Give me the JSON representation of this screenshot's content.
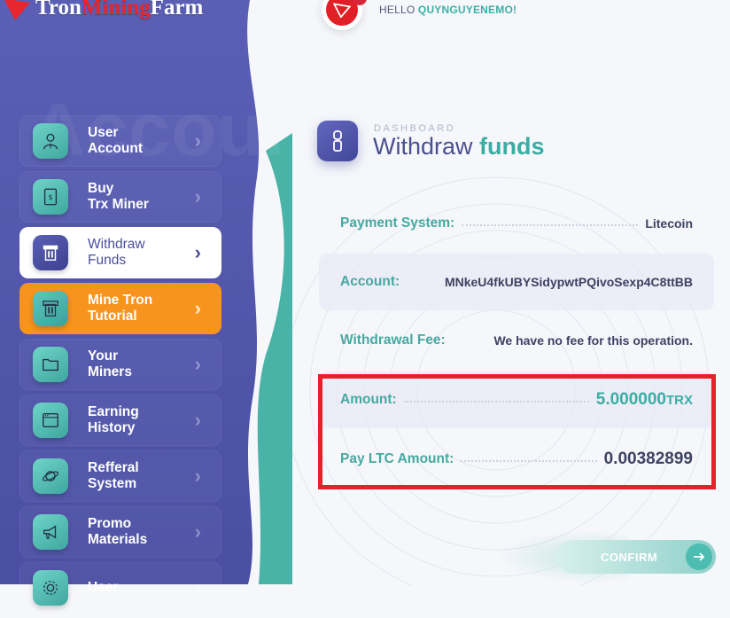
{
  "brand": {
    "name_part1": "Tron",
    "name_part2": "Mining",
    "name_part3": "Farm"
  },
  "colors": {
    "sidebar": "#5156ad",
    "accent_teal": "#3aaea3",
    "active_orange": "#f7941d",
    "highlight_red": "#e8202a"
  },
  "header": {
    "greeting": "HELLO",
    "username": "QUYNGUYENEMO!",
    "avatar_icon": "tron-logo-icon"
  },
  "sidebar": {
    "watermark": "Account",
    "items": [
      {
        "label_line1": "User",
        "label_line2": "Account",
        "icon": "user-icon"
      },
      {
        "label_line1": "Buy",
        "label_line2": "Trx Miner",
        "icon": "receipt-icon"
      },
      {
        "label_line1": "Withdraw",
        "label_line2": "Funds",
        "icon": "atm-icon",
        "state": "active"
      },
      {
        "label_line1": "Mine Tron",
        "label_line2": "Tutorial",
        "icon": "atm-icon",
        "state": "highlighted"
      },
      {
        "label_line1": "Your",
        "label_line2": "Miners",
        "icon": "folder-icon"
      },
      {
        "label_line1": "Earning",
        "label_line2": "History",
        "icon": "window-icon"
      },
      {
        "label_line1": "Refferal",
        "label_line2": "System",
        "icon": "planet-icon"
      },
      {
        "label_line1": "Promo",
        "label_line2": "Materials",
        "icon": "megaphone-icon"
      },
      {
        "label_line1": "User",
        "label_line2": "",
        "icon": "settings-icon"
      }
    ]
  },
  "main": {
    "breadcrumb": "DASHBOARD",
    "title_part1": "Withdraw",
    "title_part2": "funds",
    "fields": {
      "payment_system": {
        "label": "Payment System:",
        "value": "Litecoin"
      },
      "account": {
        "label": "Account:",
        "value": "MNkeU4fkUBYSidypwtPQivoSexp4C8ttBB"
      },
      "fee": {
        "label": "Withdrawal Fee:",
        "value": "We have no fee for this operation."
      },
      "amount": {
        "label": "Amount:",
        "value": "5.000000",
        "unit": "TRX"
      },
      "pay_ltc": {
        "label": "Pay LTC Amount:",
        "value": "0.00382899"
      }
    },
    "confirm_label": "CONFIRM"
  }
}
